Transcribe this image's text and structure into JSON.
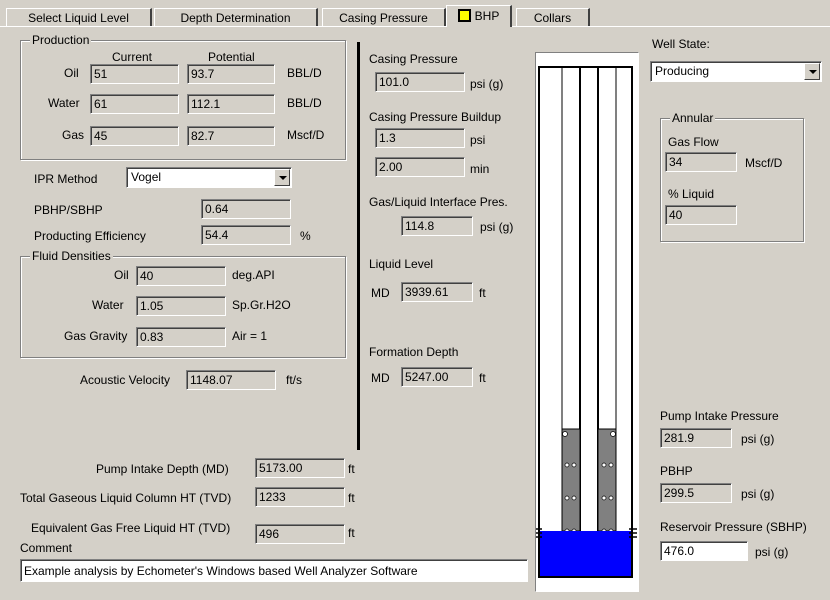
{
  "tabs": [
    {
      "label": "Select Liquid Level"
    },
    {
      "label": "Depth Determination"
    },
    {
      "label": "Casing Pressure"
    },
    {
      "label": "BHP"
    },
    {
      "label": "Collars"
    }
  ],
  "production": {
    "title": "Production",
    "col_current": "Current",
    "col_potential": "Potential",
    "rows": [
      {
        "label": "Oil",
        "current": "51",
        "potential": "93.7",
        "unit": "BBL/D"
      },
      {
        "label": "Water",
        "current": "61",
        "potential": "112.1",
        "unit": "BBL/D"
      },
      {
        "label": "Gas",
        "current": "45",
        "potential": "82.7",
        "unit": "Mscf/D"
      }
    ]
  },
  "ipr": {
    "label": "IPR Method",
    "value": "Vogel"
  },
  "pbhp_sbhp": {
    "label": "PBHP/SBHP",
    "value": "0.64"
  },
  "prod_eff": {
    "label": "Producting Efficiency",
    "value": "54.4",
    "unit": "%"
  },
  "fluid": {
    "title": "Fluid Densities",
    "oil": {
      "label": "Oil",
      "value": "40",
      "unit": "deg.API"
    },
    "water": {
      "label": "Water",
      "value": "1.05",
      "unit": "Sp.Gr.H2O"
    },
    "gas": {
      "label": "Gas Gravity",
      "value": "0.83",
      "unit": "Air = 1"
    }
  },
  "acoustic": {
    "label": "Acoustic Velocity",
    "value": "1148.07",
    "unit": "ft/s"
  },
  "pump_depth": {
    "label": "Pump Intake Depth  (MD)",
    "value": "5173.00",
    "unit": "ft"
  },
  "total_col": {
    "label": "Total Gaseous Liquid Column HT  (TVD)",
    "value": "1233",
    "unit": "ft"
  },
  "equiv_col": {
    "label": "Equivalent Gas Free Liquid HT  (TVD)",
    "value": "496",
    "unit": "ft"
  },
  "comment": {
    "label": "Comment",
    "value": "Example analysis by Echometer's Windows based Well Analyzer Software"
  },
  "casing": {
    "pressure_label": "Casing Pressure",
    "pressure_value": "101.0",
    "pressure_unit": "psi (g)",
    "buildup_label": "Casing Pressure Buildup",
    "buildup_value": "1.3",
    "buildup_unit": "psi",
    "time_value": "2.00",
    "time_unit": "min",
    "interface_label": "Gas/Liquid Interface Pres.",
    "interface_value": "114.8",
    "interface_unit": "psi (g)"
  },
  "liquid_level": {
    "label": "Liquid Level",
    "md": "MD",
    "value": "3939.61",
    "unit": "ft"
  },
  "formation": {
    "label": "Formation Depth",
    "md": "MD",
    "value": "5247.00",
    "unit": "ft"
  },
  "well_state": {
    "label": "Well State:",
    "value": "Producing"
  },
  "annular": {
    "title": "Annular",
    "gas_flow_label": "Gas Flow",
    "gas_flow_value": "34",
    "gas_flow_unit": "Mscf/D",
    "liquid_label": "% Liquid",
    "liquid_value": "40"
  },
  "pip": {
    "label": "Pump Intake Pressure",
    "value": "281.9",
    "unit": "psi (g)"
  },
  "pbhp": {
    "label": "PBHP",
    "value": "299.5",
    "unit": "psi (g)"
  },
  "sbhp": {
    "label": "Reservoir Pressure (SBHP)",
    "value": "476.0",
    "unit": "psi (g)"
  },
  "colors": {
    "liquid": "#0000ff",
    "gaseous": "#808080",
    "active_tab_icon": "#ffff00"
  }
}
